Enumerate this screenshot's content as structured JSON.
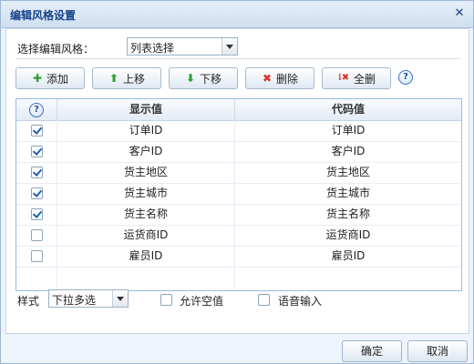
{
  "dialog": {
    "title": "编辑风格设置",
    "close_glyph": "✕"
  },
  "style_select": {
    "label": "选择编辑风格：",
    "value": "列表选择"
  },
  "toolbar": {
    "buttons": [
      {
        "label": "添加",
        "icon": "plus-icon",
        "glyph": "✚",
        "color": "#2e9e2e"
      },
      {
        "label": "上移",
        "icon": "arrow-up-icon",
        "glyph": "⬆",
        "color": "#2e9e2e"
      },
      {
        "label": "下移",
        "icon": "arrow-down-icon",
        "glyph": "⬇",
        "color": "#2e9e2e"
      },
      {
        "label": "删除",
        "icon": "delete-x-icon",
        "glyph": "✖",
        "color": "#d8332a"
      },
      {
        "label": "全删",
        "icon": "delete-all-icon",
        "glyph": "⁞✖",
        "color": "#d8332a"
      }
    ],
    "help_glyph": "?"
  },
  "grid": {
    "header_help_glyph": "?",
    "columns": [
      "显示值",
      "代码值"
    ],
    "rows": [
      {
        "checked": true,
        "display": "订单ID",
        "code": "订单ID"
      },
      {
        "checked": true,
        "display": "客户ID",
        "code": "客户ID"
      },
      {
        "checked": true,
        "display": "货主地区",
        "code": "货主地区"
      },
      {
        "checked": true,
        "display": "货主城市",
        "code": "货主城市"
      },
      {
        "checked": true,
        "display": "货主名称",
        "code": "货主名称"
      },
      {
        "checked": false,
        "display": "运货商ID",
        "code": "运货商ID"
      },
      {
        "checked": false,
        "display": "雇员ID",
        "code": "雇员ID"
      }
    ]
  },
  "options": {
    "style_label": "样式",
    "style_value": "下拉多选",
    "allow_empty": {
      "label": "允许空值",
      "checked": false
    },
    "voice_input": {
      "label": "语音输入",
      "checked": false
    }
  },
  "footer": {
    "ok_label": "确定",
    "cancel_label": "取消"
  }
}
